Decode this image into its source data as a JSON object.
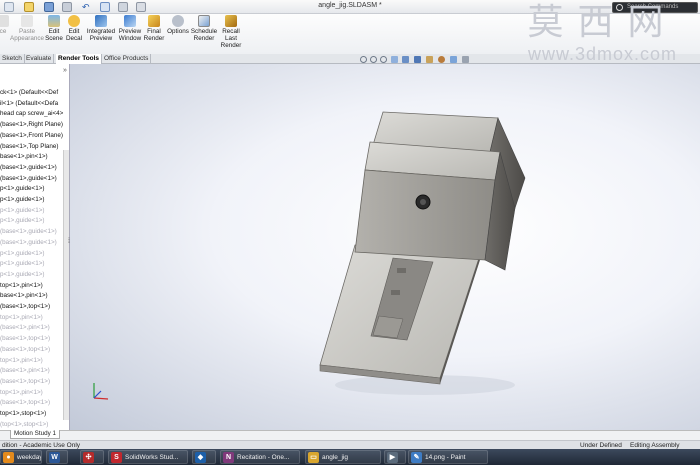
{
  "window": {
    "title": "angle_jig.SLDASM *"
  },
  "search": {
    "placeholder": "Search Commands"
  },
  "ribbon": {
    "buttons": [
      {
        "label": "ce",
        "enabled": false
      },
      {
        "label": "Paste\nAppearance",
        "enabled": false
      },
      {
        "label": "Edit\nScene",
        "enabled": true
      },
      {
        "label": "Edit\nDecal",
        "enabled": true
      },
      {
        "label": "Integrated\nPreview",
        "enabled": true
      },
      {
        "label": "Preview\nWindow",
        "enabled": true
      },
      {
        "label": "Final\nRender",
        "enabled": true
      },
      {
        "label": "Options",
        "enabled": true
      },
      {
        "label": "Schedule\nRender",
        "enabled": true
      },
      {
        "label": "Recall\nLast\nRender",
        "enabled": true
      }
    ]
  },
  "command_tabs": [
    "Sketch",
    "Evaluate",
    "Render Tools",
    "Office Products"
  ],
  "active_tab": "Render Tools",
  "tree": {
    "expand_glyph": "»",
    "items": [
      {
        "label": "ck<1> (Default<<Def",
        "dim": false
      },
      {
        "label": "il<1> (Default<<Defa",
        "dim": false
      },
      {
        "label": "head cap screw_ai<4>",
        "dim": false
      },
      {
        "label": "(base<1>,Right Plane)",
        "dim": false
      },
      {
        "label": "(base<1>,Front Plane)",
        "dim": false
      },
      {
        "label": "(base<1>,Top Plane)",
        "dim": false
      },
      {
        "label": "base<1>,pin<1>)",
        "dim": false
      },
      {
        "label": "(base<1>,guide<1>)",
        "dim": false
      },
      {
        "label": "(base<1>,guide<1>)",
        "dim": false
      },
      {
        "label": "p<1>,guide<1>)",
        "dim": false
      },
      {
        "label": "p<1>,guide<1>)",
        "dim": false
      },
      {
        "label": "p<1>,guide<1>)",
        "dim": true
      },
      {
        "label": "p<1>,guide<1>)",
        "dim": true
      },
      {
        "label": "(base<1>,guide<1>)",
        "dim": true
      },
      {
        "label": "(base<1>,guide<1>)",
        "dim": true
      },
      {
        "label": "p<1>,guide<1>)",
        "dim": true
      },
      {
        "label": "p<1>,guide<1>)",
        "dim": true
      },
      {
        "label": "p<1>,guide<1>)",
        "dim": true
      },
      {
        "label": "top<1>,pin<1>)",
        "dim": false
      },
      {
        "label": "base<1>,pin<1>)",
        "dim": false
      },
      {
        "label": "(base<1>,top<1>)",
        "dim": false
      },
      {
        "label": "top<1>,pin<1>)",
        "dim": true
      },
      {
        "label": "(base<1>,pin<1>)",
        "dim": true
      },
      {
        "label": "(base<1>,top<1>)",
        "dim": true
      },
      {
        "label": "(base<1>,top<1>)",
        "dim": true
      },
      {
        "label": "top<1>,pin<1>)",
        "dim": true
      },
      {
        "label": "(base<1>,pin<1>)",
        "dim": true
      },
      {
        "label": "(base<1>,top<1>)",
        "dim": true
      },
      {
        "label": "top<1>,pin<1>)",
        "dim": true
      },
      {
        "label": "(base<1>,top<1>)",
        "dim": true
      },
      {
        "label": "top<1>,stop<1>)",
        "dim": false
      },
      {
        "label": "(top<1>,stop<1>)",
        "dim": true
      }
    ]
  },
  "watermark": {
    "cn": "莫西网",
    "url": "www.3dmox.com"
  },
  "motion_study": {
    "tab": "Motion Study 1"
  },
  "status": {
    "left": "dition - Academic Use Only",
    "definition": "Under Defined",
    "mode": "Editing Assembly"
  },
  "taskbar": {
    "items": [
      {
        "label": "weekday - ...",
        "icon": "rss-icon",
        "icon_char": "●",
        "color": "#e38a1c"
      },
      {
        "label": "",
        "icon": "word-icon",
        "icon_char": "W",
        "color": "#2b5797"
      },
      {
        "label": "",
        "icon": "network-icon",
        "icon_char": "✣",
        "color": "#b52b2b"
      },
      {
        "label": "SolidWorks Stud...",
        "icon": "solidworks-icon",
        "icon_char": "S",
        "color": "#c1272d"
      },
      {
        "label": "",
        "icon": "visio-icon",
        "icon_char": "◆",
        "color": "#1d5fa8"
      },
      {
        "label": "Recitation - One...",
        "icon": "onenote-icon",
        "icon_char": "N",
        "color": "#80397b"
      },
      {
        "label": "angle_jig",
        "icon": "folder-icon",
        "icon_char": "▭",
        "color": "#d9a62e"
      },
      {
        "label": "",
        "icon": "media-icon",
        "icon_char": "▶",
        "color": "#5b6b7c"
      },
      {
        "label": "14.png - Paint",
        "icon": "paint-icon",
        "icon_char": "✎",
        "color": "#3e7cc4"
      }
    ]
  }
}
